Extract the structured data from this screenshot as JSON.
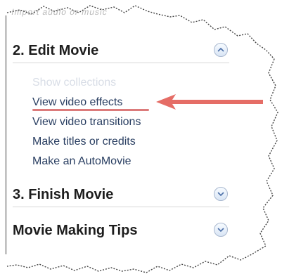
{
  "panel": {
    "top_text": "Import audio or music",
    "sections": [
      {
        "title": "2. Edit Movie",
        "expanded": true,
        "chevron_icon": "chevron-up-icon"
      },
      {
        "title": "3. Finish Movie",
        "expanded": false,
        "chevron_icon": "chevron-down-icon"
      },
      {
        "title": "Movie Making Tips",
        "expanded": false,
        "chevron_icon": "chevron-down-icon"
      }
    ],
    "tasks": [
      {
        "label": "Show collections",
        "faded": true
      },
      {
        "label": "View video effects",
        "highlighted": true
      },
      {
        "label": "View video transitions"
      },
      {
        "label": "Make titles or credits"
      },
      {
        "label": "Make an AutoMovie"
      }
    ]
  },
  "colors": {
    "arrow": "#e56d66",
    "link": "#2a3f62",
    "divider": "#d7d7d7",
    "chevron_border": "#a9b8cf"
  }
}
